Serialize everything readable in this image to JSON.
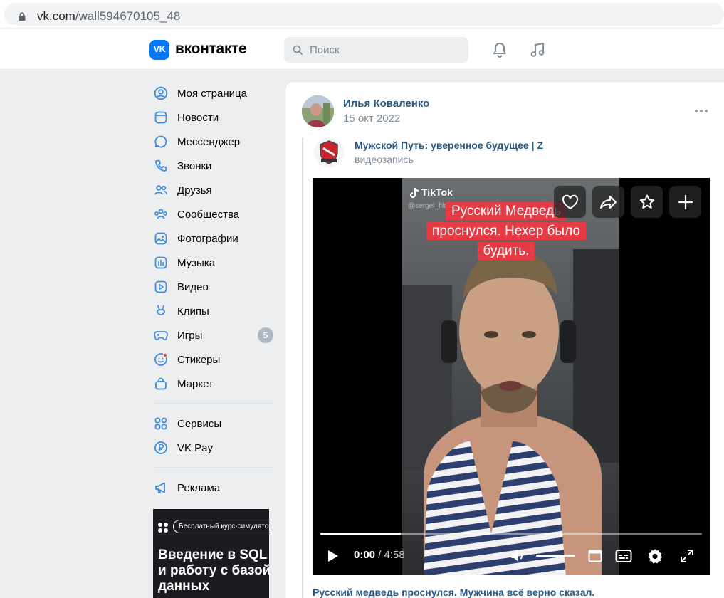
{
  "browser": {
    "url_host": "vk.com",
    "url_path": "/wall594670105_48"
  },
  "header": {
    "logo_mark": "VK",
    "logo_text": "вконтакте",
    "search_placeholder": "Поиск",
    "icons": [
      "search-icon",
      "bell-icon",
      "music-note-icon"
    ]
  },
  "sidebar": {
    "items": [
      {
        "label": "Моя страница",
        "icon": "user-circle-icon"
      },
      {
        "label": "Новости",
        "icon": "news-icon"
      },
      {
        "label": "Мессенджер",
        "icon": "message-icon"
      },
      {
        "label": "Звонки",
        "icon": "phone-icon"
      },
      {
        "label": "Друзья",
        "icon": "friends-icon"
      },
      {
        "label": "Сообщества",
        "icon": "communities-icon"
      },
      {
        "label": "Фотографии",
        "icon": "photo-icon"
      },
      {
        "label": "Музыка",
        "icon": "music-icon"
      },
      {
        "label": "Видео",
        "icon": "video-icon"
      },
      {
        "label": "Клипы",
        "icon": "clips-icon"
      },
      {
        "label": "Игры",
        "icon": "gamepad-icon",
        "badge": "5"
      },
      {
        "label": "Стикеры",
        "icon": "sticker-icon"
      },
      {
        "label": "Маркет",
        "icon": "market-bag-icon"
      }
    ],
    "services": [
      {
        "label": "Сервисы",
        "icon": "services-grid-icon"
      },
      {
        "label": "VK Pay",
        "icon": "vkpay-icon"
      }
    ],
    "ads": [
      {
        "label": "Реклама",
        "icon": "megaphone-icon"
      }
    ]
  },
  "ad_banner": {
    "pill": "Бесплатный курс-симулятор",
    "title": "Введение в SQL и работу с базой данных"
  },
  "post": {
    "author": "Илья Коваленко",
    "date": "15 окт 2022",
    "repost": {
      "group_name": "Мужской Путь: уверенное будущее | Z",
      "subtitle": "видеозапись"
    },
    "video": {
      "watermark": "TikTok",
      "watermark_user": "@sergei_filosof",
      "caption": "Русский Медведь проснулся. Нехер было будить.",
      "time_current": "0:00",
      "time_sep": " / ",
      "time_total": "4:58",
      "progress": 0.21,
      "volume": 1.0,
      "action_icons": [
        "heart-icon",
        "share-icon",
        "star-icon",
        "plus-icon"
      ]
    },
    "title": "Русский медведь проснулся. Мужчина всё верно сказал."
  },
  "colors": {
    "accent": "#0077ff",
    "link": "#2a5885",
    "muted": "#818c99",
    "caption_bg": "#e63a45",
    "page_bg": "#edeef0"
  }
}
